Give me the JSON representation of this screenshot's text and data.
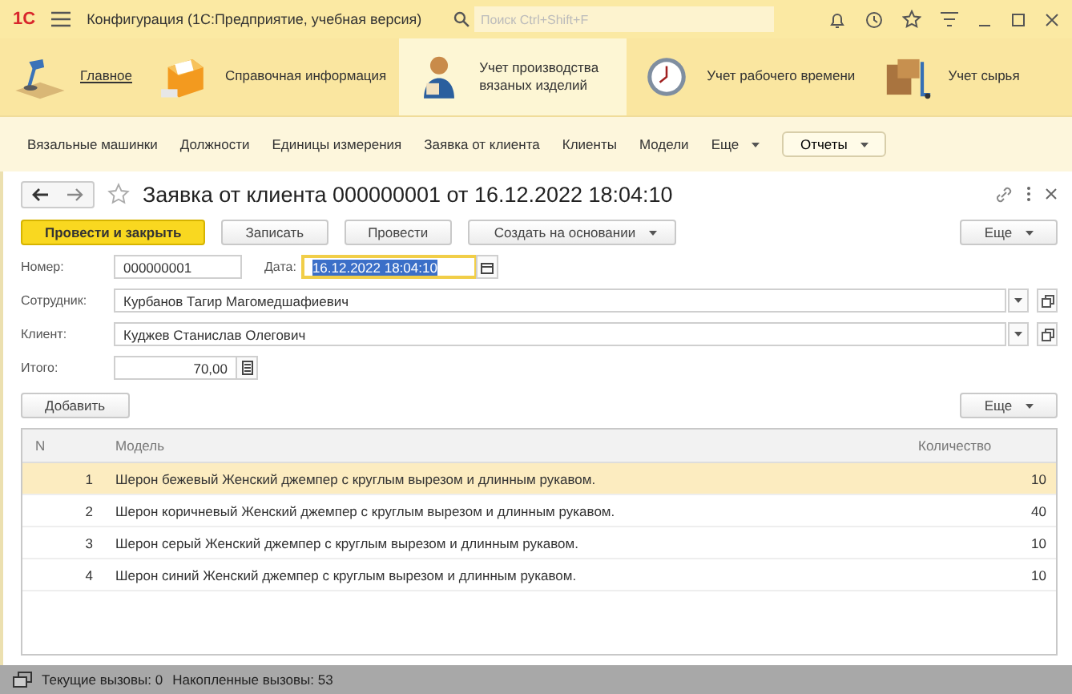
{
  "window": {
    "logo": "1С",
    "title": "Конфигурация  (1С:Предприятие, учебная версия)",
    "search": {
      "placeholder": "Поиск Ctrl+Shift+F"
    }
  },
  "sections": [
    {
      "label": "Главное",
      "kind": "lamp",
      "link": true,
      "selected": false
    },
    {
      "label": "Справочная информация",
      "kind": "cabinet",
      "link": false,
      "selected": false
    },
    {
      "label": "Учет производства вязаных изделий",
      "kind": "figure",
      "link": false,
      "selected": true
    },
    {
      "label": "Учет рабочего времени",
      "kind": "clock",
      "link": false,
      "selected": false
    },
    {
      "label": "Учет сырья",
      "kind": "crates",
      "link": false,
      "selected": false
    }
  ],
  "nav": [
    {
      "label": "Вязальные машинки",
      "kind": "link"
    },
    {
      "label": "Должности",
      "kind": "link"
    },
    {
      "label": "Единицы измерения",
      "kind": "link"
    },
    {
      "label": "Заявка от клиента",
      "kind": "link"
    },
    {
      "label": "Клиенты",
      "kind": "link"
    },
    {
      "label": "Модели",
      "kind": "link"
    },
    {
      "label": "Еще",
      "kind": "dropdown"
    },
    {
      "label": "Отчеты",
      "kind": "button"
    }
  ],
  "form": {
    "title": "Заявка от клиента 000000001 от 16.12.2022 18:04:10",
    "buttons": [
      {
        "label": "Провести и закрыть",
        "kind": "primary"
      },
      {
        "label": "Записать",
        "kind": "plain"
      },
      {
        "label": "Провести",
        "kind": "plain"
      },
      {
        "label": "Создать на основании",
        "kind": "dropdown"
      }
    ],
    "more": "Еще",
    "number": {
      "label": "Номер:",
      "value": "000000001"
    },
    "date": {
      "label": "Дата:",
      "value": "16.12.2022 18:04:10",
      "selected": true
    },
    "employee": {
      "label": "Сотрудник:",
      "value": "Курбанов Тагир Магомедшафиевич"
    },
    "client": {
      "label": "Клиент:",
      "value": "Куджев Станислав Олегович"
    },
    "total": {
      "label": "Итого:",
      "value": "70,00"
    }
  },
  "table": {
    "add": "Добавить",
    "more": "Еще",
    "columns": [
      "N",
      "Модель",
      "Количество"
    ],
    "rows": [
      {
        "n": "1",
        "model": "Шерон бежевый Женский джемпер с круглым вырезом и длинным рукавом.",
        "qty": "10",
        "selected": true
      },
      {
        "n": "2",
        "model": "Шерон коричневый Женский джемпер с круглым вырезом и длинным рукавом.",
        "qty": "40",
        "selected": false
      },
      {
        "n": "3",
        "model": "Шерон серый Женский джемпер с круглым вырезом и длинным рукавом.",
        "qty": "10",
        "selected": false
      },
      {
        "n": "4",
        "model": "Шерон синий Женский джемпер с круглым вырезом и длинным рукавом.",
        "qty": "10",
        "selected": false
      }
    ]
  },
  "status": {
    "current": "Текущие вызовы: 0",
    "accumulated": "Накопленные вызовы: 53"
  }
}
